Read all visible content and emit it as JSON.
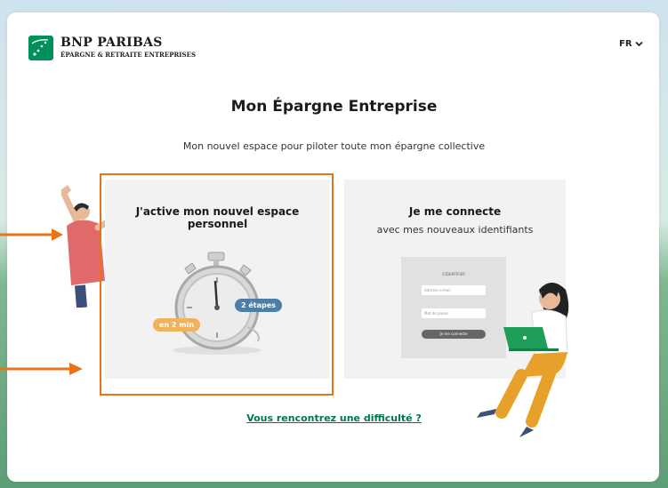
{
  "header": {
    "brand": "BNP PARIBAS",
    "brand_sub": "ÉPARGNE & RETRAITE ENTREPRISES",
    "language": "FR"
  },
  "main": {
    "title": "Mon Épargne Entreprise",
    "subtitle": "Mon nouvel espace pour piloter toute mon épargne collective"
  },
  "cards": {
    "activate": {
      "title": "J'active mon nouvel espace personnel",
      "badge_time": "en 2 min",
      "badge_steps": "2 étapes"
    },
    "connect": {
      "title": "Je me connecte",
      "subtitle": "avec mes nouveaux identifiants",
      "mini_form_title": "S'IDENTIFIER",
      "mini_email_placeholder": "Adresse e-mail",
      "mini_password_placeholder": "Mot de passe",
      "mini_button": "Je me connecte"
    }
  },
  "footer": {
    "help_link": "Vous rencontrez une difficulté ?"
  },
  "colors": {
    "brand_green": "#00915a",
    "highlight_orange": "#e8731b",
    "link_green": "#00794a",
    "badge_orange": "#f0b25a",
    "badge_blue": "#4f7ea5"
  },
  "icons": [
    "bnp-logo-icon",
    "chevron-down-icon",
    "stopwatch-icon",
    "annotation-arrow-icon"
  ]
}
